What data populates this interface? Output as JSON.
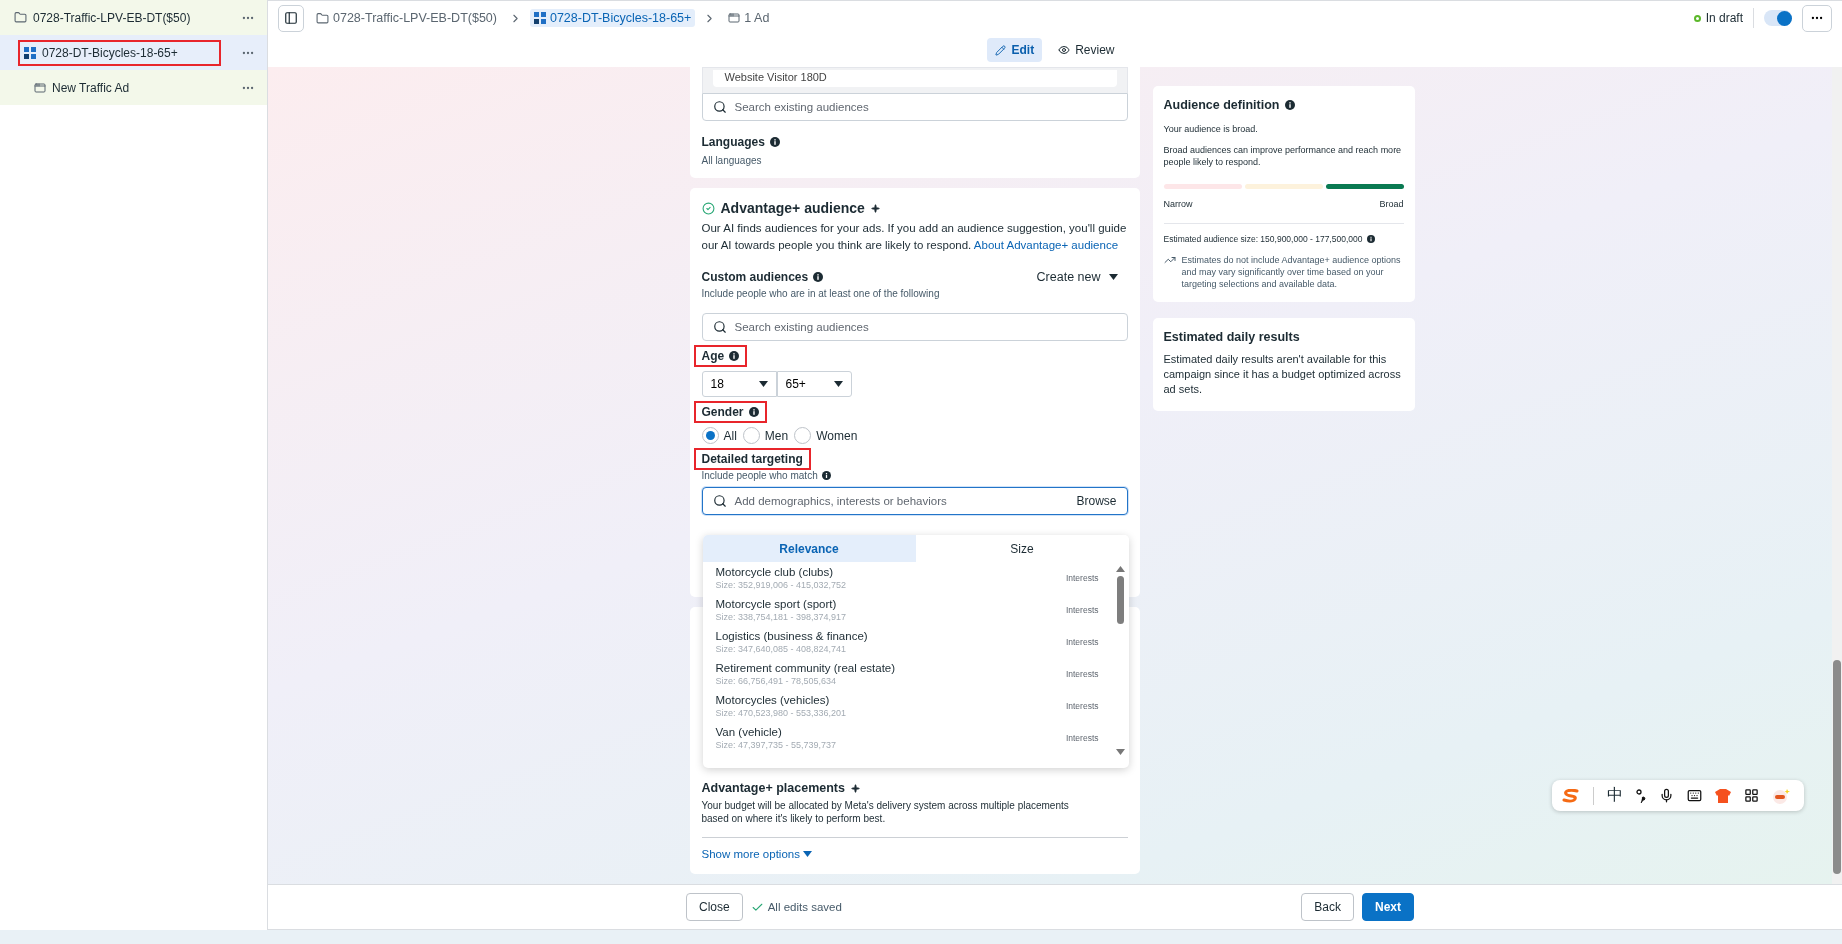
{
  "sidebar": {
    "items": [
      {
        "label": "0728-Traffic-LPV-EB-DT($50)",
        "kind": "campaign",
        "selected": false,
        "highlighted": false,
        "children": [
          {
            "label": "0728-DT-Bicycles-18-65+",
            "kind": "adset",
            "selected": true,
            "highlighted": true,
            "children": [
              {
                "label": "New Traffic Ad",
                "kind": "ad",
                "selected": false,
                "highlighted": false
              }
            ]
          }
        ]
      }
    ]
  },
  "breadcrumb": [
    {
      "label": "0728-Traffic-LPV-EB-DT($50)",
      "kind": "campaign",
      "selected": false
    },
    {
      "label": "0728-DT-Bicycles-18-65+",
      "kind": "adset",
      "selected": true
    },
    {
      "label": "1 Ad",
      "kind": "ad",
      "selected": false
    }
  ],
  "status": {
    "label": "In draft"
  },
  "toggle": {
    "on": true
  },
  "mode_tabs": [
    {
      "label": "Edit",
      "kind": "edit",
      "selected": true
    },
    {
      "label": "Review",
      "kind": "review",
      "selected": false
    }
  ],
  "audience_card": {
    "saved_audience": "Website Visitor 180D",
    "search_placeholder": "Search existing audiences",
    "languages": {
      "label": "Languages",
      "value": "All languages"
    }
  },
  "advantage_audience": {
    "title": "Advantage+ audience",
    "description": "Our AI finds audiences for your ads. If you add an audience suggestion, you'll guide our AI towards people you think are likely to respond.",
    "link": "About Advantage+ audience",
    "custom_audiences": {
      "label": "Custom audiences",
      "hint": "Include people who are in at least one of the following",
      "create_new": "Create new",
      "search_placeholder": "Search existing audiences"
    },
    "age": {
      "label": "Age",
      "highlighted": true,
      "min": "18",
      "max": "65+"
    },
    "gender": {
      "label": "Gender",
      "highlighted": true,
      "options": [
        {
          "label": "All",
          "selected": true
        },
        {
          "label": "Men",
          "selected": false
        },
        {
          "label": "Women",
          "selected": false
        }
      ]
    },
    "detailed_targeting": {
      "label": "Detailed targeting",
      "highlighted": true,
      "hint": "Include people who match",
      "placeholder": "Add demographics, interests or behaviors",
      "browse": "Browse"
    }
  },
  "suggestions": {
    "tabs": [
      {
        "label": "Relevance",
        "selected": true
      },
      {
        "label": "Size",
        "selected": false
      }
    ],
    "items": [
      {
        "name": "Motorcycle club (clubs)",
        "size": "Size: 352,919,006 - 415,032,752",
        "category": "Interests"
      },
      {
        "name": "Motorcycle sport (sport)",
        "size": "Size: 338,754,181 - 398,374,917",
        "category": "Interests"
      },
      {
        "name": "Logistics (business & finance)",
        "size": "Size: 347,640,085 - 408,824,741",
        "category": "Interests"
      },
      {
        "name": "Retirement community (real estate)",
        "size": "Size: 66,756,491 - 78,505,634",
        "category": "Interests"
      },
      {
        "name": "Motorcycles (vehicles)",
        "size": "Size: 470,523,980 - 553,336,201",
        "category": "Interests"
      },
      {
        "name": "Van (vehicle)",
        "size": "Size: 47,397,735 - 55,739,737",
        "category": "Interests"
      }
    ]
  },
  "placements": {
    "title": "Advantage+ placements",
    "description": "Your budget will be allocated by Meta's delivery system across multiple placements based on where it's likely to perform best.",
    "show_more": "Show more options"
  },
  "audience_definition": {
    "title": "Audience definition",
    "verdict": "Your audience is broad.",
    "description": "Broad audiences can improve performance and reach more people likely to respond.",
    "meter": [
      {
        "color": "#fde6e8"
      },
      {
        "color": "#fdf2dc"
      },
      {
        "color": "#0a7a52"
      }
    ],
    "low_label": "Narrow",
    "high_label": "Broad",
    "estimated_size": "Estimated audience size: 150,900,000 - 177,500,000",
    "note": "Estimates do not include Advantage+ audience options and may vary significantly over time based on your targeting selections and available data."
  },
  "daily_results": {
    "title": "Estimated daily results",
    "text": "Estimated daily results aren't available for this campaign since it has a budget optimized across ad sets."
  },
  "footer": {
    "close": "Close",
    "saved": "All edits saved",
    "back": "Back",
    "next": "Next"
  },
  "ime_toolbar": {
    "mode": "中"
  }
}
